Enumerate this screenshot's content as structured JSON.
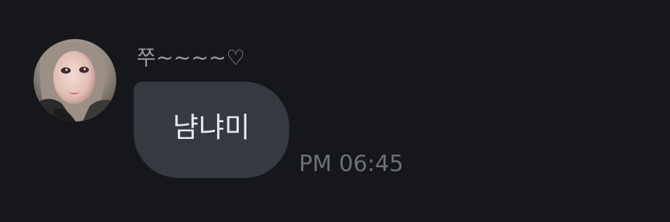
{
  "chat": {
    "message": {
      "sender_name": "쭈~~~~♡",
      "text": "냠냐미",
      "time": "PM 06:45"
    },
    "avatar_icon": "profile-photo",
    "colors": {
      "background": "#16171b",
      "bubble": "#363940",
      "bubble_text": "#e6e7ea",
      "sender_text": "#9a9ba2",
      "time_text": "#6e7077"
    }
  }
}
